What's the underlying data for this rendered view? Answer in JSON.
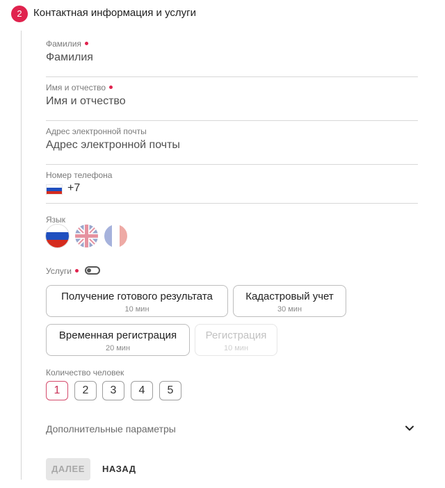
{
  "section": {
    "step_number": "2",
    "title": "Контактная информация и услуги"
  },
  "form": {
    "last_name": {
      "label": "Фамилия",
      "placeholder": "Фамилия",
      "required": true
    },
    "first_name": {
      "label": "Имя и отчество",
      "placeholder": "Имя и отчество",
      "required": true
    },
    "email": {
      "label": "Адрес электронной почты",
      "placeholder": "Адрес электронной почты",
      "required": false
    },
    "phone": {
      "label": "Номер телефона",
      "country_flag": "russia-flag-icon",
      "value": "+7"
    }
  },
  "language": {
    "label": "Язык",
    "options": [
      {
        "name": "russia-flag-icon",
        "selected": true
      },
      {
        "name": "uk-flag-icon",
        "selected": false
      },
      {
        "name": "france-flag-icon",
        "selected": false
      }
    ]
  },
  "services": {
    "label": "Услуги",
    "required": true,
    "toggle_on": false,
    "items": [
      {
        "title": "Получение готового результата",
        "duration": "10 мин",
        "enabled": true
      },
      {
        "title": "Кадастровый учет",
        "duration": "30 мин",
        "enabled": true
      },
      {
        "title": "Временная регистрация",
        "duration": "20 мин",
        "enabled": true
      },
      {
        "title": "Регистрация",
        "duration": "10 мин",
        "enabled": false
      }
    ]
  },
  "people_count": {
    "label": "Количество человек",
    "options": [
      "1",
      "2",
      "3",
      "4",
      "5"
    ],
    "selected": "1"
  },
  "extra_params": {
    "label": "Дополнительные параметры",
    "icon": "chevron-down-icon"
  },
  "actions": {
    "next_label": "ДАЛЕЕ",
    "back_label": "НАЗАД"
  },
  "colors": {
    "accent": "#e0234e",
    "border": "#d8d8d8",
    "muted_text": "#7a7a7a"
  }
}
